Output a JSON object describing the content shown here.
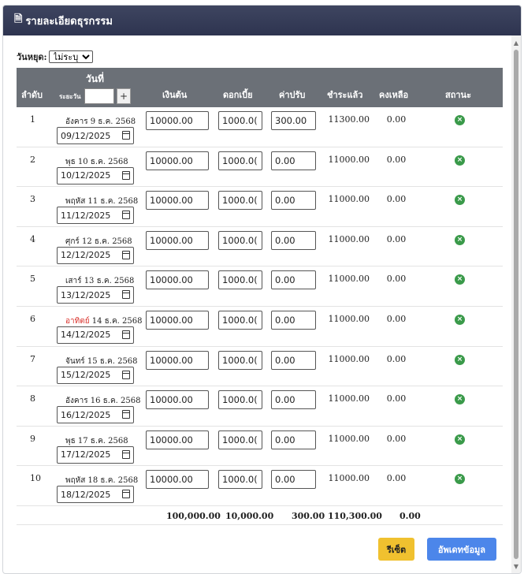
{
  "window": {
    "title": "รายละเอียดธุรกรรม",
    "title_icon": "document-icon"
  },
  "filter": {
    "label": "วันหยุด:",
    "selected": "ไม่ระบุ"
  },
  "table": {
    "headers": {
      "no": "ลำดับ",
      "date": "วันที่",
      "range_label": "ระยะวัน",
      "range_add": "+",
      "principal": "เงินต้น",
      "interest": "ดอกเบี้ย",
      "fine": "ค่าปรับ",
      "paid": "ชำระแล้ว",
      "remaining": "คงเหลือ",
      "status": "สถานะ"
    },
    "rows": [
      {
        "no": "1",
        "weekday": "อังคาร",
        "day_rest": " 9 ธ.ค. 2568",
        "date": "09/12/2025",
        "principal": "10000.00",
        "interest": "1000.0(",
        "fine": "300.00",
        "paid": "11300.00",
        "remaining": "0.00",
        "status_icon": "close-circle-icon"
      },
      {
        "no": "2",
        "weekday": "พุธ",
        "day_rest": " 10 ธ.ค. 2568",
        "date": "10/12/2025",
        "principal": "10000.00",
        "interest": "1000.0(",
        "fine": "0.00",
        "paid": "11000.00",
        "remaining": "0.00",
        "status_icon": "close-circle-icon"
      },
      {
        "no": "3",
        "weekday": "พฤหัส",
        "day_rest": " 11 ธ.ค. 2568",
        "date": "11/12/2025",
        "principal": "10000.00",
        "interest": "1000.0(",
        "fine": "0.00",
        "paid": "11000.00",
        "remaining": "0.00",
        "status_icon": "close-circle-icon"
      },
      {
        "no": "4",
        "weekday": "ศุกร์",
        "day_rest": " 12 ธ.ค. 2568",
        "date": "12/12/2025",
        "principal": "10000.00",
        "interest": "1000.0(",
        "fine": "0.00",
        "paid": "11000.00",
        "remaining": "0.00",
        "status_icon": "close-circle-icon"
      },
      {
        "no": "5",
        "weekday": "เสาร์",
        "day_rest": " 13 ธ.ค. 2568",
        "date": "13/12/2025",
        "principal": "10000.00",
        "interest": "1000.0(",
        "fine": "0.00",
        "paid": "11000.00",
        "remaining": "0.00",
        "status_icon": "close-circle-icon"
      },
      {
        "no": "6",
        "weekday": "อาทิตย์",
        "day_rest": " 14 ธ.ค. 2568",
        "date": "14/12/2025",
        "principal": "10000.00",
        "interest": "1000.0(",
        "fine": "0.00",
        "paid": "11000.00",
        "remaining": "0.00",
        "status_icon": "close-circle-icon",
        "sunday": true
      },
      {
        "no": "7",
        "weekday": "จันทร์",
        "day_rest": " 15 ธ.ค. 2568",
        "date": "15/12/2025",
        "principal": "10000.00",
        "interest": "1000.0(",
        "fine": "0.00",
        "paid": "11000.00",
        "remaining": "0.00",
        "status_icon": "close-circle-icon"
      },
      {
        "no": "8",
        "weekday": "อังคาร",
        "day_rest": " 16 ธ.ค. 2568",
        "date": "16/12/2025",
        "principal": "10000.00",
        "interest": "1000.0(",
        "fine": "0.00",
        "paid": "11000.00",
        "remaining": "0.00",
        "status_icon": "close-circle-icon"
      },
      {
        "no": "9",
        "weekday": "พุธ",
        "day_rest": " 17 ธ.ค. 2568",
        "date": "17/12/2025",
        "principal": "10000.00",
        "interest": "1000.0(",
        "fine": "0.00",
        "paid": "11000.00",
        "remaining": "0.00",
        "status_icon": "close-circle-icon"
      },
      {
        "no": "10",
        "weekday": "พฤหัส",
        "day_rest": " 18 ธ.ค. 2568",
        "date": "18/12/2025",
        "principal": "10000.00",
        "interest": "1000.0(",
        "fine": "0.00",
        "paid": "11000.00",
        "remaining": "0.00",
        "status_icon": "close-circle-icon"
      }
    ],
    "totals": {
      "principal": "100,000.00",
      "interest": "10,000.00",
      "fine": "300.00",
      "paid": "110,300.00",
      "remaining": "0.00"
    }
  },
  "buttons": {
    "reset": "รีเซ็ต",
    "update": "อัพเดทข้อมูล"
  },
  "colors": {
    "titlebar": "#343a55",
    "header": "#6b7077",
    "status_green": "#3a9a4a",
    "sunday_red": "#d9302a",
    "reset_yellow": "#f0c12f",
    "update_blue": "#4c86ea"
  }
}
